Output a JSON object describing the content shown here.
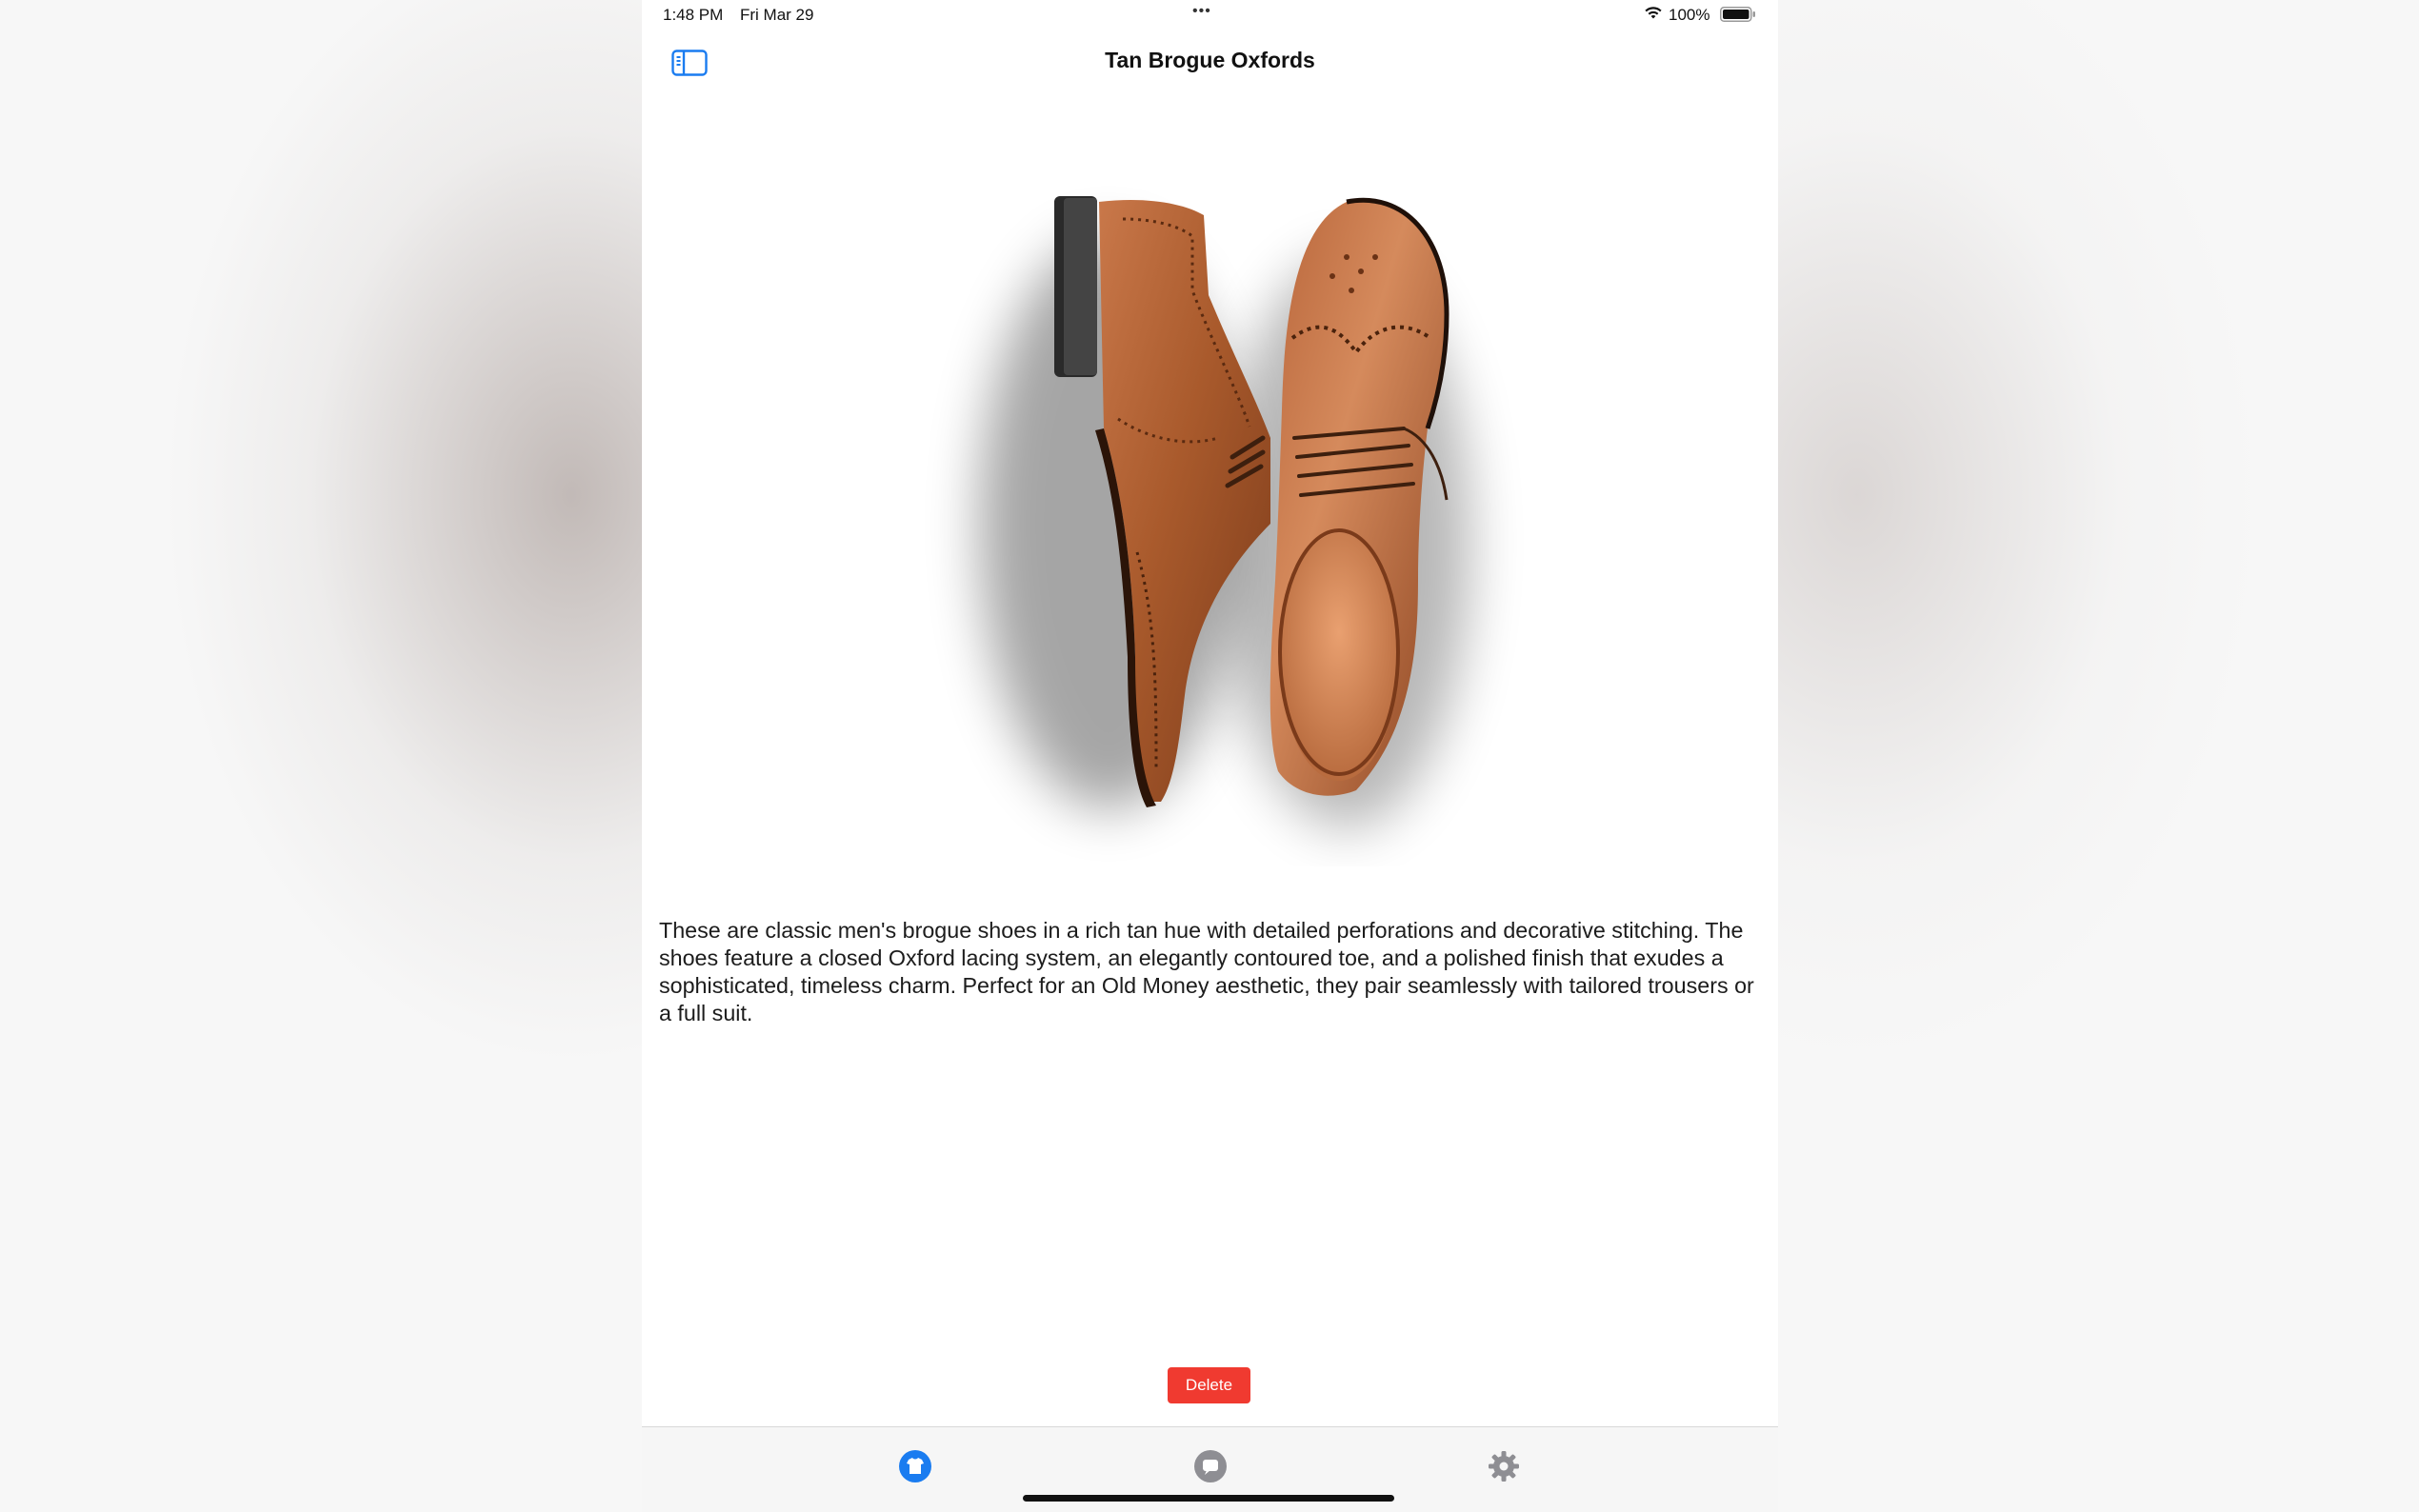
{
  "status_bar": {
    "time": "1:48 PM",
    "date": "Fri Mar 29",
    "dots": "•••",
    "battery_percent": "100%"
  },
  "nav": {
    "title": "Tan Brogue Oxfords",
    "sidebar_icon": "sidebar-toggle-icon"
  },
  "item": {
    "image_subject": "tan-brogue-oxford-shoes",
    "description": "These are classic men's brogue shoes in a rich tan hue with detailed perforations and decorative stitching. The shoes feature a closed Oxford lacing system, an elegantly contoured toe, and a polished finish that exudes a sophisticated, timeless charm. Perfect for an Old Money aesthetic, they pair seamlessly with tailored trousers or a full suit."
  },
  "actions": {
    "delete_label": "Delete"
  },
  "tabs": [
    {
      "icon": "shirt-icon",
      "selected": true
    },
    {
      "icon": "chat-bubble-icon",
      "selected": false
    },
    {
      "icon": "gear-icon",
      "selected": false
    }
  ],
  "colors": {
    "accent": "#1a7cf0",
    "destructive": "#f03a30",
    "tab_inactive": "#8e8e93",
    "leather": "#a6582c"
  }
}
